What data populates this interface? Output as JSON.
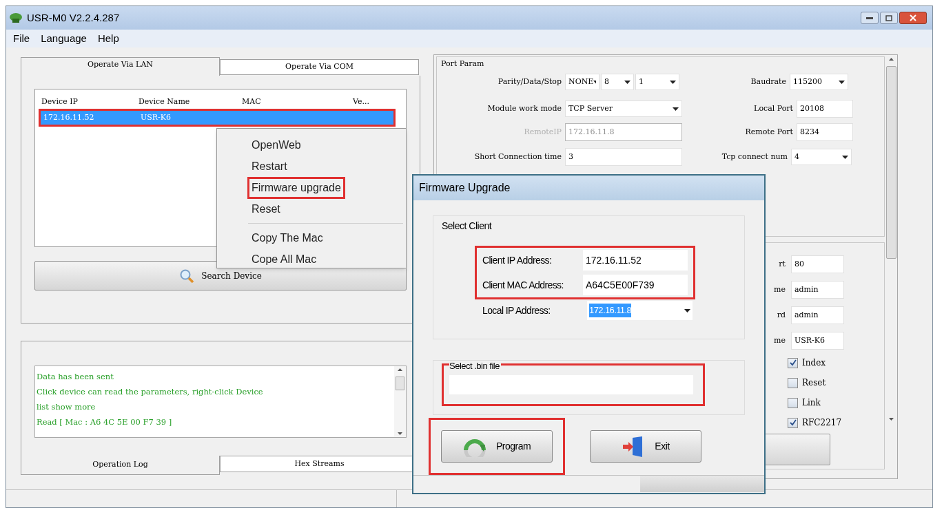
{
  "window": {
    "title": "USR-M0 V2.2.4.287"
  },
  "menu": [
    "File",
    "Language",
    "Help"
  ],
  "device_panel": {
    "tabs": [
      {
        "label": "Operate Via LAN",
        "selected": true
      },
      {
        "label": "Operate Via COM",
        "selected": false
      }
    ],
    "columns": [
      "Device IP",
      "Device Name",
      "MAC",
      "Ve..."
    ],
    "rows": [
      {
        "cells": [
          "172.16.11.52",
          "USR-K6"
        ],
        "selected": true,
        "highlighted": true
      }
    ],
    "search_button": "Search Device"
  },
  "log_panel": {
    "lines": [
      "Data has been sent",
      "Click device can read the parameters, right-click Device list show more",
      "Read [ Mac : A6 4C 5E 00 F7 39 ]"
    ],
    "tabs": [
      {
        "label": "Operation Log",
        "selected": true
      },
      {
        "label": "Hex Streams",
        "selected": false
      }
    ]
  },
  "port_param": {
    "title": "Port Param",
    "parity_data_stop": {
      "label": "Parity/Data/Stop",
      "values": [
        "NONE",
        "8",
        "1"
      ]
    },
    "baudrate": {
      "label": "Baudrate",
      "value": "115200"
    },
    "work_mode": {
      "label": "Module work mode",
      "value": "TCP Server"
    },
    "local_port": {
      "label": "Local Port",
      "value": "20108"
    },
    "remote_ip": {
      "label": "RemoteIP",
      "value": "172.16.11.8",
      "disabled": true
    },
    "remote_port": {
      "label": "Remote Port",
      "value": "8234"
    },
    "short_connection": {
      "label": "Short Connection time",
      "value": "3"
    },
    "tcp_connect_num": {
      "label": "Tcp connect num",
      "value": "4"
    }
  },
  "web_settings": {
    "fields": [
      {
        "label": "rt",
        "value": "80"
      },
      {
        "label": "me",
        "value": "admin"
      },
      {
        "label": "rd",
        "value": "admin"
      },
      {
        "label": "me",
        "value": "USR-K6"
      }
    ],
    "options": [
      {
        "label": "Index",
        "checked": true
      },
      {
        "label": "Reset",
        "checked": false
      },
      {
        "label": "Link",
        "checked": false
      },
      {
        "label": "RFC2217",
        "checked": true
      }
    ]
  },
  "context_menu": {
    "items": [
      {
        "kind": "item",
        "label": "OpenWeb",
        "highlighted": false
      },
      {
        "kind": "item",
        "label": "Restart",
        "highlighted": false
      },
      {
        "kind": "item",
        "label": "Firmware upgrade",
        "highlighted": true
      },
      {
        "kind": "item",
        "label": "Reset",
        "highlighted": false
      },
      {
        "kind": "separator"
      },
      {
        "kind": "item",
        "label": "Copy The Mac",
        "highlighted": false
      },
      {
        "kind": "item",
        "label": "Cope All Mac",
        "highlighted": false
      }
    ]
  },
  "dialog": {
    "title": "Firmware Upgrade",
    "client_group": {
      "title": "Select Client",
      "highlighted": true,
      "fields": [
        {
          "label": "Client IP Address:",
          "value": "172.16.11.52"
        },
        {
          "label": "Client MAC Address:",
          "value": "A64C5E00F739"
        }
      ],
      "local_ip": {
        "label": "Local IP Address:",
        "value": "172.16.11.8",
        "text_selected": true
      }
    },
    "file_group": {
      "title": "Select .bin file",
      "highlighted": true
    },
    "buttons": [
      {
        "kind": "program",
        "label": "Program",
        "highlighted": true
      },
      {
        "kind": "exit",
        "label": "Exit",
        "highlighted": false
      }
    ]
  }
}
